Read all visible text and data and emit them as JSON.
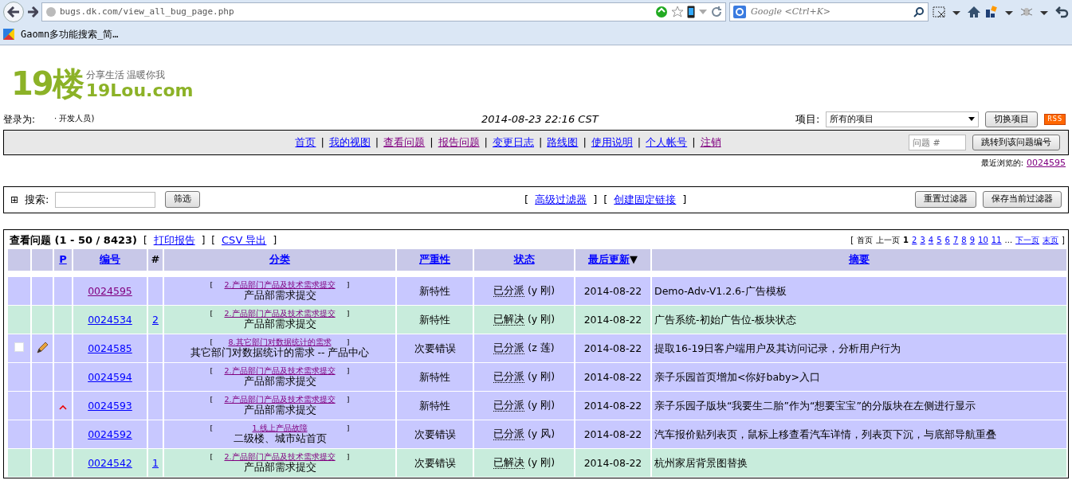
{
  "browser": {
    "url": "bugs.dk.com/view_all_bug_page.php",
    "search_placeholder": "Google <Ctrl+K>",
    "bookmarks": [
      "Gaomn多功能搜索_简…"
    ]
  },
  "header": {
    "logo_main": "19楼",
    "logo_domain": "19Lou.com",
    "logo_slogan": "分享生活 温暖你我",
    "login_label": "登录为:",
    "login_role": "· 开发人员)",
    "datetime": "2014-08-23 22:16 CST",
    "project_label": "项目:",
    "project_value": "所有的项目",
    "switch_button": "切换项目",
    "rss": "RSS"
  },
  "nav": {
    "links": [
      {
        "label": "首页",
        "visited": false
      },
      {
        "separator": "|",
        "label": "我的视图",
        "visited": false
      },
      {
        "separator": "|",
        "label": "查看问题",
        "visited": true
      },
      {
        "separator": "|",
        "label": "报告问题",
        "visited": true
      },
      {
        "separator": "|",
        "label": "变更日志",
        "visited": false
      },
      {
        "separator": "|",
        "label": "路线图",
        "visited": false
      },
      {
        "separator": "|",
        "label": "使用说明",
        "visited": false
      },
      {
        "separator": "|",
        "label": "个人帐号",
        "visited": false
      },
      {
        "separator": "|",
        "label": "注销",
        "visited": true
      }
    ],
    "jump_placeholder": "问题 #",
    "jump_button": "跳转到该问题编号"
  },
  "recent": {
    "label": "最近浏览的:",
    "issue": "0024595"
  },
  "filter": {
    "toggle": "⊞",
    "label": "搜索:",
    "button": "筛选",
    "links": [
      {
        "open": "[",
        "label": "高级过滤器",
        "close": "]"
      },
      {
        "open": "[",
        "label": "创建固定链接",
        "close": "]"
      }
    ],
    "buttons": [
      "重置过滤器",
      "保存当前过滤器"
    ]
  },
  "list": {
    "title": "查看问题 (1 - 50 / 8423)",
    "actions": [
      {
        "open": "[",
        "label": "打印报告",
        "close": "]"
      },
      {
        "open": "[",
        "label": "CSV 导出",
        "close": "]"
      }
    ],
    "pagination_open": "[",
    "pagination_close": "]",
    "pagination": [
      {
        "label": "首页",
        "kind": "text"
      },
      {
        "label": "上一页",
        "kind": "text"
      },
      {
        "label": "1",
        "kind": "current"
      },
      {
        "label": "2",
        "kind": "link"
      },
      {
        "label": "3",
        "kind": "link"
      },
      {
        "label": "4",
        "kind": "link"
      },
      {
        "label": "5",
        "kind": "link"
      },
      {
        "label": "6",
        "kind": "link"
      },
      {
        "label": "7",
        "kind": "link"
      },
      {
        "label": "8",
        "kind": "link"
      },
      {
        "label": "9",
        "kind": "link"
      },
      {
        "label": "10",
        "kind": "link"
      },
      {
        "label": "11",
        "kind": "link"
      },
      {
        "label": "...",
        "kind": "text"
      },
      {
        "label": "下一页",
        "kind": "link"
      },
      {
        "label": "末页",
        "kind": "link"
      }
    ],
    "columns": [
      {},
      {},
      {
        "label": "P",
        "link": true
      },
      {
        "label": "编号",
        "link": true
      },
      {
        "label": "#",
        "link": false
      },
      {
        "label": "分类",
        "link": true
      },
      {
        "label": "严重性",
        "link": true
      },
      {
        "label": "状态",
        "link": true
      },
      {
        "label": "最后更新",
        "link": true,
        "sort_indicator": "▼"
      },
      {
        "label": "摘要",
        "link": true
      }
    ],
    "rows": [
      {
        "color": "#c8c8ff",
        "checkbox": false,
        "editable": false,
        "high_priority": false,
        "id": "0024595",
        "id_visited": true,
        "category_open": "[",
        "category": "2.产品部门产品及技术需求提交",
        "category_close": "]",
        "project": "产品部需求提交",
        "severity": "新特性",
        "status": "已分派",
        "handler": "(y 刚)",
        "updated": "2014-08-22",
        "summary": "Demo-Adv-V1.2.6-广告模板"
      },
      {
        "color": "#c8ecdc",
        "checkbox": false,
        "editable": false,
        "high_priority": false,
        "id": "0024534",
        "id_visited": false,
        "notes": "2",
        "category_open": "[",
        "category": "2.产品部门产品及技术需求提交",
        "category_close": "]",
        "project": "产品部需求提交",
        "severity": "新特性",
        "status": "已解决",
        "handler": "(y 刚)",
        "updated": "2014-08-22",
        "summary": "广告系统-初始广告位-板块状态"
      },
      {
        "color": "#c8c8ff",
        "checkbox": true,
        "editable": true,
        "high_priority": false,
        "id": "0024585",
        "id_visited": false,
        "category_open": "[",
        "category": "8.其它部门对数据统计的需求",
        "category_close": "]",
        "project": "其它部门对数据统计的需求 -- 产品中心",
        "severity": "次要错误",
        "status": "已分派",
        "handler": "(z 莲)",
        "updated": "2014-08-22",
        "summary": "提取16-19日客户端用户及其访问记录，分析用户行为"
      },
      {
        "color": "#c8c8ff",
        "checkbox": false,
        "editable": false,
        "high_priority": false,
        "id": "0024594",
        "id_visited": false,
        "category_open": "[",
        "category": "2.产品部门产品及技术需求提交",
        "category_close": "]",
        "project": "产品部需求提交",
        "severity": "新特性",
        "status": "已分派",
        "handler": "(y 刚)",
        "updated": "2014-08-22",
        "summary": "亲子乐园首页增加<你好baby>入口"
      },
      {
        "color": "#c8c8ff",
        "checkbox": false,
        "editable": false,
        "high_priority": true,
        "id": "0024593",
        "id_visited": false,
        "category_open": "[",
        "category": "2.产品部门产品及技术需求提交",
        "category_close": "]",
        "project": "产品部需求提交",
        "severity": "新特性",
        "status": "已分派",
        "handler": "(y 刚)",
        "updated": "2014-08-22",
        "summary": "亲子乐园子版块“我要生二胎”作为“想要宝宝”的分版块在左侧进行显示"
      },
      {
        "color": "#c8c8ff",
        "checkbox": false,
        "editable": false,
        "high_priority": false,
        "id": "0024592",
        "id_visited": false,
        "category_open": "[",
        "category": "1.线上产品故障",
        "category_close": "]",
        "project": "二级楼、城市站首页",
        "severity": "次要错误",
        "status": "已分派",
        "handler": "(y 风)",
        "updated": "2014-08-22",
        "summary": "汽车报价贴列表页，鼠标上移查看汽车详情，列表页下沉，与底部导航重叠"
      },
      {
        "color": "#c8ecdc",
        "checkbox": false,
        "editable": false,
        "high_priority": false,
        "id": "0024542",
        "id_visited": false,
        "notes": "1",
        "category_open": "[",
        "category": "2.产品部门产品及技术需求提交",
        "category_close": "]",
        "project": "产品部需求提交",
        "severity": "次要错误",
        "status": "已解决",
        "handler": "(y 刚)",
        "updated": "2014-08-22",
        "summary": "杭州家居背景图替换"
      }
    ]
  }
}
